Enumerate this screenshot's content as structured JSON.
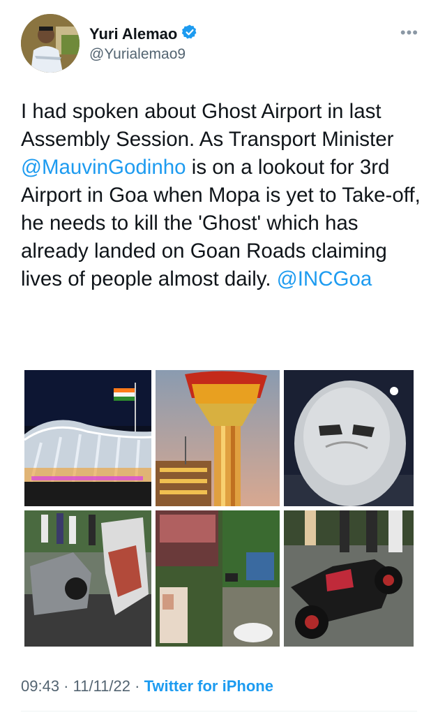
{
  "author": {
    "name": "Yuri Alemao",
    "handle": "@Yurialemao9",
    "verified": true
  },
  "more_icon": "more-horizontal-icon",
  "tweet": {
    "segments": [
      {
        "text": "I had spoken about Ghost Airport in last Assembly Session. As Transport Minister ",
        "type": "text"
      },
      {
        "text": "@MauvinGodinho",
        "type": "mention"
      },
      {
        "text": " is on a lookout for 3rd Airport in Goa when Mopa is yet to Take-off, he needs to kill the 'Ghost' which has already landed on Goan Roads claiming lives of people almost daily. ",
        "type": "text"
      },
      {
        "text": "@INCGoa",
        "type": "mention"
      }
    ]
  },
  "meta": {
    "time": "09:43",
    "sep1": " · ",
    "date": "11/11/22",
    "sep2": " · ",
    "source": "Twitter for iPhone"
  },
  "colors": {
    "accent": "#1d9bf0",
    "text": "#0f1419",
    "muted": "#536471"
  }
}
